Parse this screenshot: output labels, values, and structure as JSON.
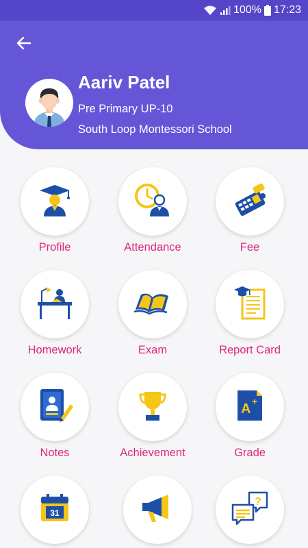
{
  "status_bar": {
    "battery": "100%",
    "time": "17:23"
  },
  "header": {
    "name": "Aariv Patel",
    "class": "Pre Primary UP-10",
    "school": "South Loop Montessori School"
  },
  "menu": [
    {
      "label": "Profile",
      "icon": "graduate-icon"
    },
    {
      "label": "Attendance",
      "icon": "clock-person-icon"
    },
    {
      "label": "Fee",
      "icon": "calculator-icon"
    },
    {
      "label": "Homework",
      "icon": "study-desk-icon"
    },
    {
      "label": "Exam",
      "icon": "open-book-icon"
    },
    {
      "label": "Report Card",
      "icon": "report-card-icon"
    },
    {
      "label": "Notes",
      "icon": "notebook-pencil-icon"
    },
    {
      "label": "Achievement",
      "icon": "trophy-icon"
    },
    {
      "label": "Grade",
      "icon": "grade-a-plus-icon"
    },
    {
      "label": "",
      "icon": "calendar-icon",
      "text": "31"
    },
    {
      "label": "",
      "icon": "megaphone-icon"
    },
    {
      "label": "",
      "icon": "chat-question-icon"
    }
  ],
  "colors": {
    "header": "#6556d8",
    "status_bar": "#5545c8",
    "label": "#e0257c",
    "icon_blue": "#1d4fa8",
    "icon_yellow": "#f5c518"
  }
}
